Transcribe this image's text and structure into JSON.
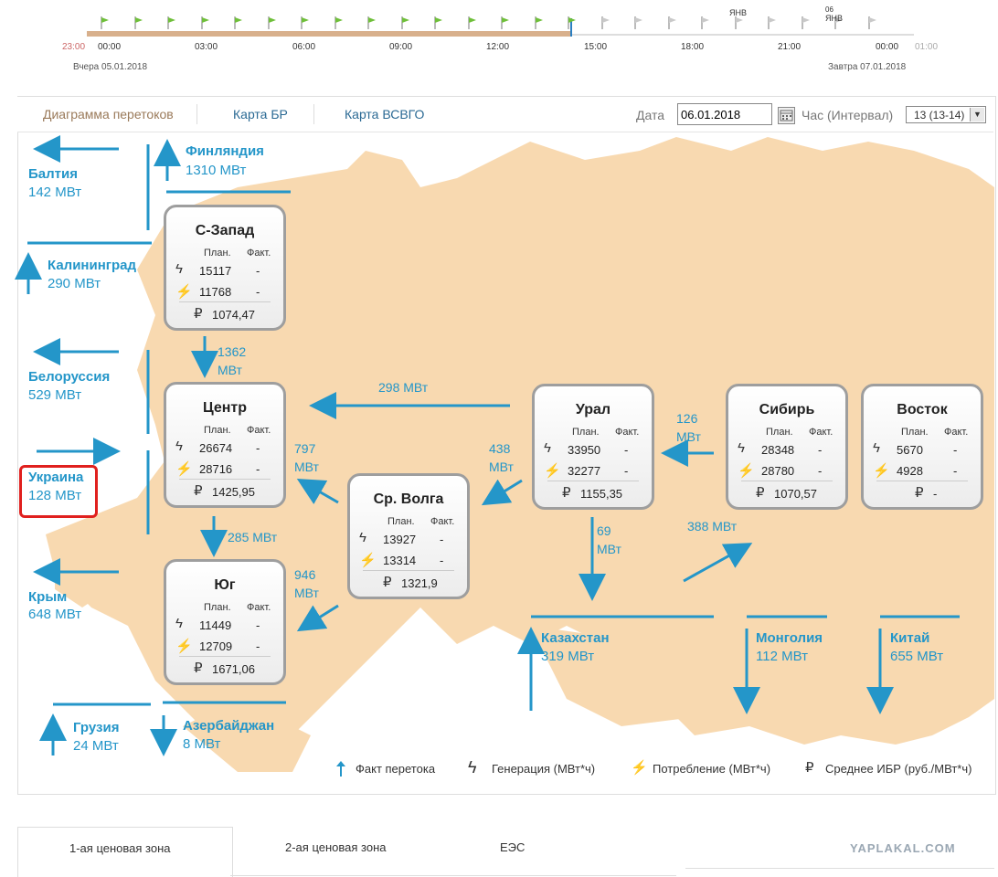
{
  "timeline": {
    "hours": [
      "23:00",
      "00:00",
      "03:00",
      "06:00",
      "09:00",
      "12:00",
      "15:00",
      "18:00",
      "21:00",
      "00:00",
      "01:00"
    ],
    "yesterday": "Вчера 05.01.2018",
    "tomorrow": "Завтра 07.01.2018",
    "marker1": "ЯНВ",
    "marker2a": "06",
    "marker2b": "ЯНВ"
  },
  "tabs": {
    "flows": "Диаграмма перетоков",
    "map_br": "Карта БР",
    "map_vsvgo": "Карта ВСВГО"
  },
  "filters": {
    "date_label": "Дата",
    "date_value": "06.01.2018",
    "hour_label": "Час (Интервал)",
    "hour_value": "13 (13-14)"
  },
  "regions": {
    "plan": "План.",
    "fact": "Факт.",
    "szapad": {
      "name": "С-Запад",
      "gen": "15117",
      "gen_f": "-",
      "cons": "11768",
      "cons_f": "-",
      "price": "1074,47"
    },
    "center": {
      "name": "Центр",
      "gen": "26674",
      "gen_f": "-",
      "cons": "28716",
      "cons_f": "-",
      "price": "1425,95"
    },
    "yug": {
      "name": "Юг",
      "gen": "11449",
      "gen_f": "-",
      "cons": "12709",
      "cons_f": "-",
      "price": "1671,06"
    },
    "volga": {
      "name": "Ср. Волга",
      "gen": "13927",
      "gen_f": "-",
      "cons": "13314",
      "cons_f": "-",
      "price": "1321,9"
    },
    "ural": {
      "name": "Урал",
      "gen": "33950",
      "gen_f": "-",
      "cons": "32277",
      "cons_f": "-",
      "price": "1155,35"
    },
    "sibir": {
      "name": "Сибирь",
      "gen": "28348",
      "gen_f": "-",
      "cons": "28780",
      "cons_f": "-",
      "price": "1070,57"
    },
    "vostok": {
      "name": "Восток",
      "gen": "5670",
      "gen_f": "-",
      "cons": "4928",
      "cons_f": "-",
      "price": "-"
    }
  },
  "external": {
    "baltia": {
      "name": "Балтия",
      "val": "142 МВт"
    },
    "finland": {
      "name": "Финляндия",
      "val": "1310 МВт"
    },
    "kaliningrad": {
      "name": "Калининград",
      "val": "290 МВт"
    },
    "belarus": {
      "name": "Белоруссия",
      "val": "529 МВт"
    },
    "ukraine": {
      "name": "Украина",
      "val": "128 МВт"
    },
    "crimea": {
      "name": "Крым",
      "val": "648 МВт"
    },
    "georgia": {
      "name": "Грузия",
      "val": "24 МВт"
    },
    "azerbaijan": {
      "name": "Азербайджан",
      "val": "8 МВт"
    },
    "kazakhstan": {
      "name": "Казахстан",
      "val": "319 МВт"
    },
    "mongolia": {
      "name": "Монголия",
      "val": "112 МВт"
    },
    "china": {
      "name": "Китай",
      "val": "655 МВт"
    }
  },
  "flows": {
    "szapad_center_a": "1362",
    "szapad_center_b": "МВт",
    "ural_center": "298 МВт",
    "volga_center_a": "797",
    "volga_center_b": "МВт",
    "center_yug": "285 МВт",
    "volga_yug_a": "946",
    "volga_yug_b": "МВт",
    "ural_volga_a": "438",
    "ural_volga_b": "МВт",
    "sibir_ural_a": "126",
    "sibir_ural_b": "МВт",
    "ural_kz_a": "69",
    "ural_kz_b": "МВт",
    "kz_sibir": "388 МВт"
  },
  "legend": {
    "fact": "Факт перетока",
    "gen": "Генерация (МВт*ч)",
    "cons": "Потребление (МВт*ч)",
    "price": "Среднее ИБР (руб./МВт*ч)"
  },
  "bottom_tabs": {
    "zone1": "1-ая ценовая зона",
    "zone2": "2-ая ценовая зона",
    "ees": "ЕЭС"
  },
  "watermark": "YAPLAKAL.COM",
  "colors": {
    "accent": "#2496c9",
    "map": "#f8d9b0",
    "highlight": "#e0201e"
  }
}
